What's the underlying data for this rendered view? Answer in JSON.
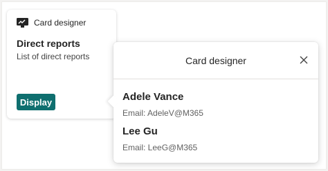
{
  "card": {
    "app_name": "Card designer",
    "title": "Direct reports",
    "subtitle": "List of direct reports",
    "button_label": "Display"
  },
  "popup": {
    "title": "Card designer",
    "people": [
      {
        "name": "Adele Vance",
        "email": "Email: AdeleV@M365"
      },
      {
        "name": "Lee Gu",
        "email": "Email: LeeG@M365"
      }
    ]
  },
  "colors": {
    "accent": "#0f6f6f",
    "background": "#f3f2f1"
  },
  "icons": {
    "app": "card-designer-icon",
    "close": "close-icon"
  }
}
